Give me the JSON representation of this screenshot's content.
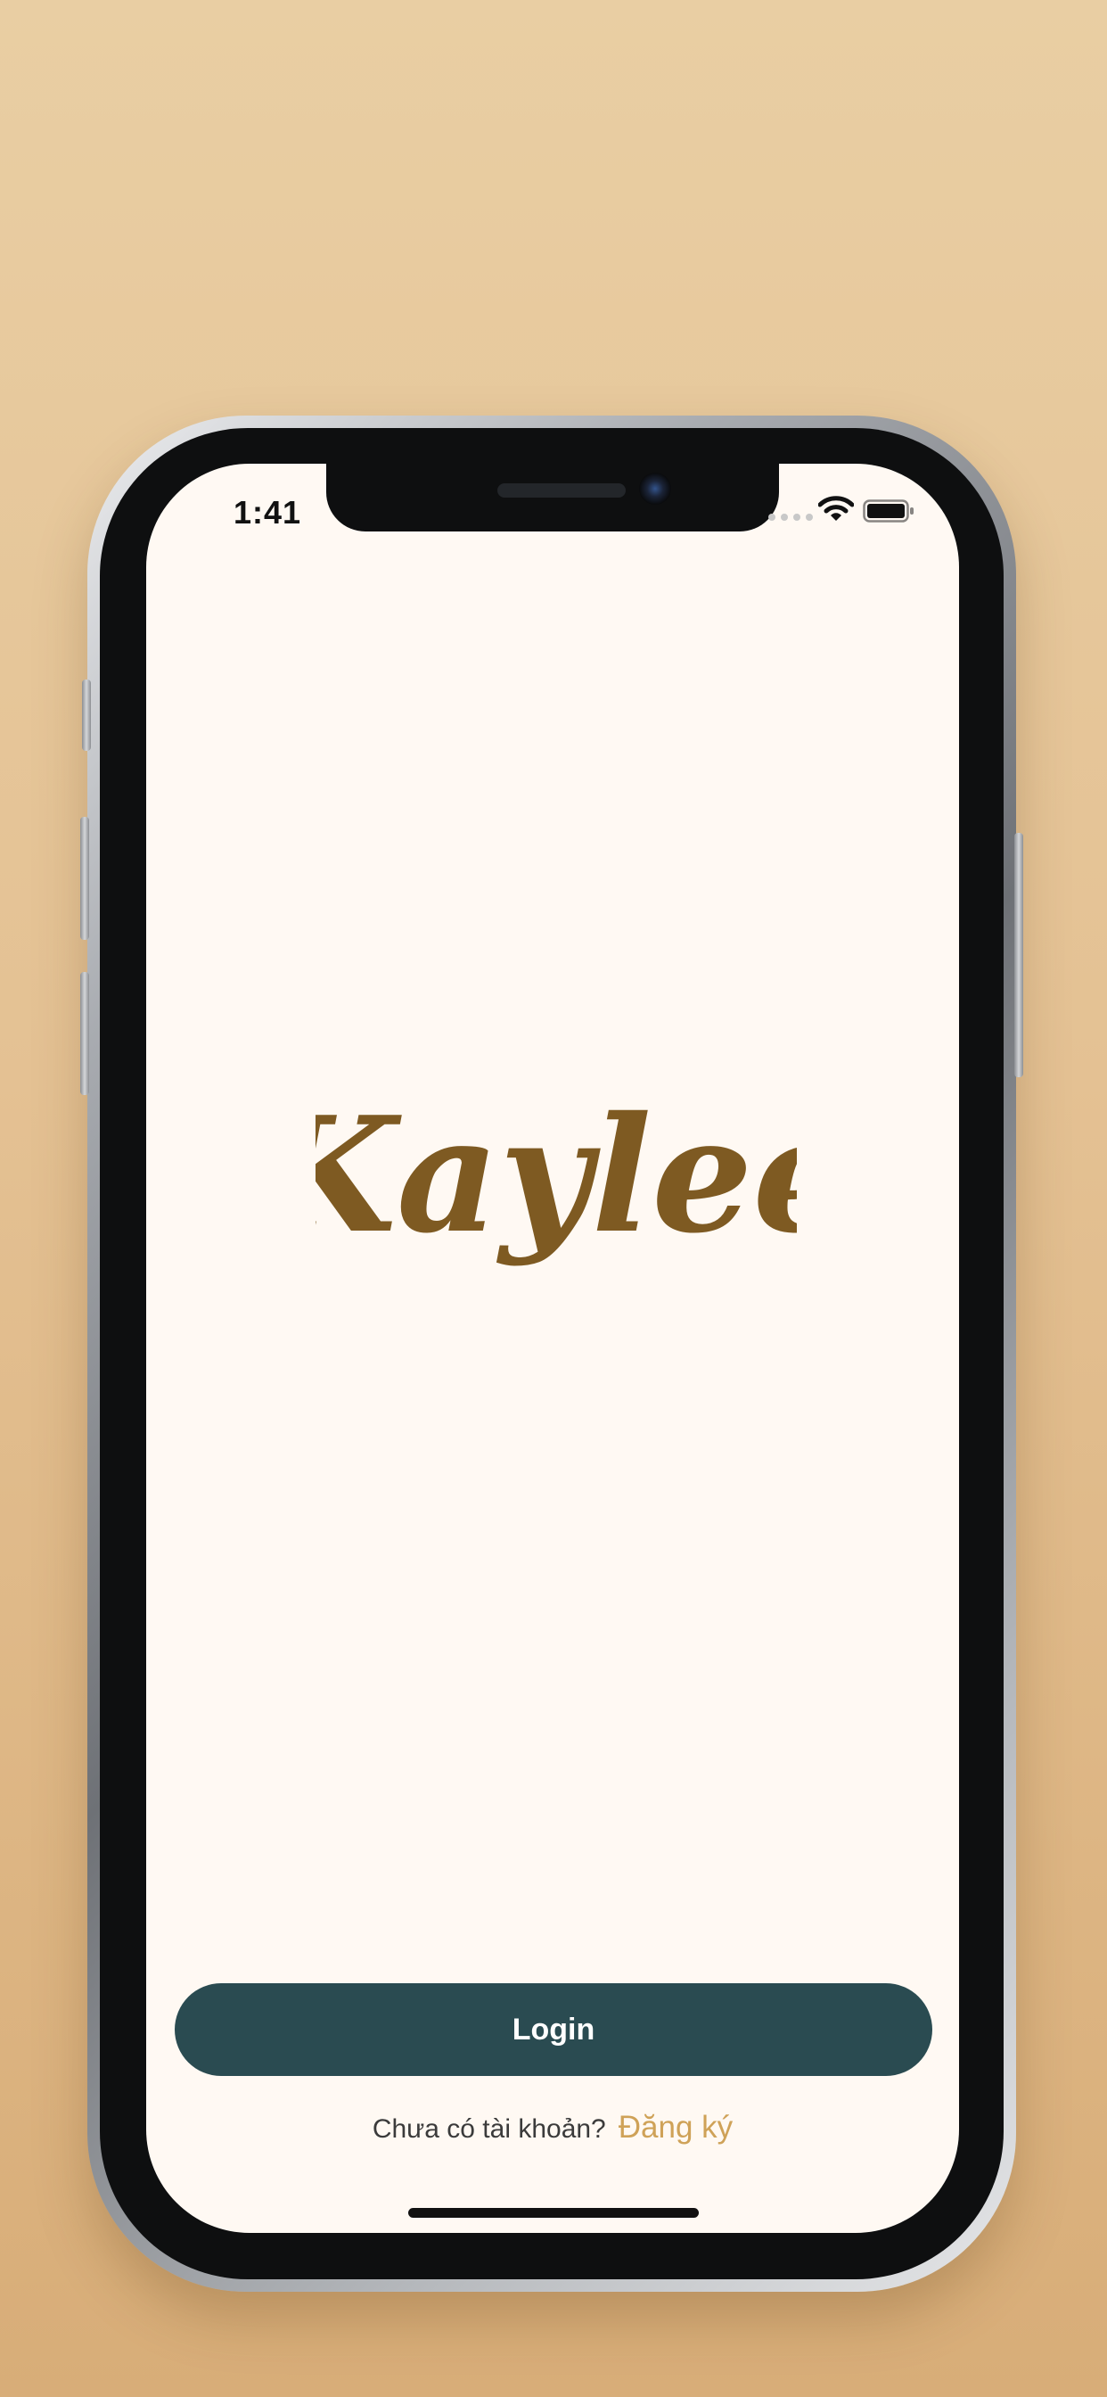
{
  "status_bar": {
    "time": "1:41"
  },
  "brand": {
    "logo_text": "Kaylee",
    "logo_color": "#7E5A22"
  },
  "auth": {
    "login_label": "Login",
    "signup_prompt": "Chưa có tài khoản?",
    "signup_link": "Đăng ký"
  },
  "colors": {
    "background": "#FFF9F3",
    "login_button": "#2A4B51",
    "signup_link": "#CFA258",
    "backdrop": "#E4C193"
  },
  "icons": {
    "wifi": "wifi-icon",
    "battery": "battery-icon",
    "camera": "camera-icon"
  }
}
